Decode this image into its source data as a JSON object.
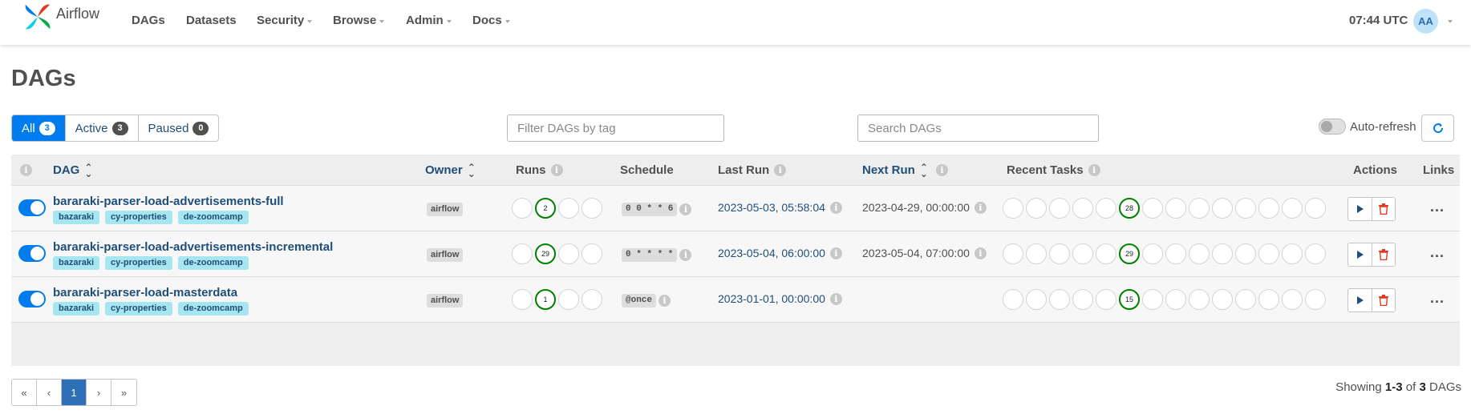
{
  "nav": {
    "brand": "Airflow",
    "items": [
      {
        "label": "DAGs",
        "dropdown": false
      },
      {
        "label": "Datasets",
        "dropdown": false
      },
      {
        "label": "Security",
        "dropdown": true
      },
      {
        "label": "Browse",
        "dropdown": true
      },
      {
        "label": "Admin",
        "dropdown": true
      },
      {
        "label": "Docs",
        "dropdown": true
      }
    ],
    "clock": "07:44 UTC",
    "avatar": "AA"
  },
  "page_title": "DAGs",
  "filters": {
    "all": {
      "label": "All",
      "count": "3"
    },
    "active": {
      "label": "Active",
      "count": "3"
    },
    "paused": {
      "label": "Paused",
      "count": "0"
    }
  },
  "tag_filter_placeholder": "Filter DAGs by tag",
  "search_placeholder": "Search DAGs",
  "auto_refresh_label": "Auto-refresh",
  "table": {
    "headers": {
      "dag": "DAG",
      "owner": "Owner",
      "runs": "Runs",
      "schedule": "Schedule",
      "last_run": "Last Run",
      "next_run": "Next Run",
      "recent_tasks": "Recent Tasks",
      "actions": "Actions",
      "links": "Links"
    },
    "rows": [
      {
        "dag_id": "bararaki-parser-load-advertisements-full",
        "tags": [
          "bazaraki",
          "cy-properties",
          "de-zoomcamp"
        ],
        "owner": "airflow",
        "runs_success": "2",
        "schedule": "0 0 * * 6",
        "last_run": "2023-05-03, 05:58:04",
        "next_run": "2023-04-29, 00:00:00",
        "recent_success": "28"
      },
      {
        "dag_id": "bararaki-parser-load-advertisements-incremental",
        "tags": [
          "bazaraki",
          "cy-properties",
          "de-zoomcamp"
        ],
        "owner": "airflow",
        "runs_success": "29",
        "schedule": "0 * * * *",
        "last_run": "2023-05-04, 06:00:00",
        "next_run": "2023-05-04, 07:00:00",
        "recent_success": "29"
      },
      {
        "dag_id": "bararaki-parser-load-masterdata",
        "tags": [
          "bazaraki",
          "cy-properties",
          "de-zoomcamp"
        ],
        "owner": "airflow",
        "runs_success": "1",
        "schedule": "@once",
        "last_run": "2023-01-01, 00:00:00",
        "next_run": "",
        "recent_success": "15"
      }
    ],
    "links_label": "..."
  },
  "pagination": {
    "first": "«",
    "prev": "‹",
    "current": "1",
    "next": "›",
    "last": "»"
  },
  "showing": {
    "prefix": "Showing ",
    "range": "1-3",
    "middle": " of ",
    "total": "3",
    "suffix": " DAGs"
  },
  "colors": {
    "primary": "#017cee",
    "link": "#1f4e79",
    "success": "#008000",
    "tag_bg": "#a6e6f0",
    "delete": "#e43921"
  }
}
